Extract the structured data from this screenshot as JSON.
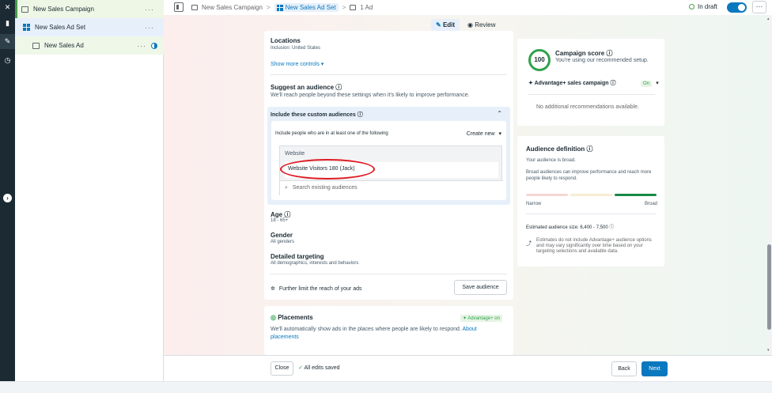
{
  "tree": {
    "campaign": "New Sales Campaign",
    "adset": "New Sales Ad Set",
    "ad": "New Sales Ad",
    "more": "···"
  },
  "topbar": {
    "crumb1": "New Sales Campaign",
    "crumb2": "New Sales Ad Set",
    "crumb3": "1 Ad",
    "sep": ">",
    "status": "In draft",
    "more": "···"
  },
  "tabs": {
    "edit": "Edit",
    "review": "Review"
  },
  "locations": {
    "title": "Locations",
    "value": "Inclusion: United States",
    "more_controls": "Show more controls ▾"
  },
  "suggest": {
    "title": "Suggest an audience",
    "desc": "We'll reach people beyond these settings when it's likely to improve performance."
  },
  "custom": {
    "title": "Include these custom audiences",
    "include_text": "Include people who are in at least one of the following",
    "create_new": "Create new",
    "group": "Website",
    "audience": "Website Visitors 180 (Jack)",
    "search_placeholder": "Search existing audiences"
  },
  "age": {
    "title": "Age",
    "value": "18 - 65+"
  },
  "gender": {
    "title": "Gender",
    "value": "All genders"
  },
  "detailed": {
    "title": "Detailed targeting",
    "value": "All demographics, interests and behaviors"
  },
  "further": {
    "label": "Further limit the reach of your ads",
    "save": "Save audience"
  },
  "placements": {
    "title": "Placements",
    "badge": "Advantage+ on",
    "desc": "We'll automatically show ads in the places where people are likely to respond.",
    "link": "About placements"
  },
  "score": {
    "value": "100",
    "title": "Campaign score",
    "desc": "You're using our recommended setup.",
    "adv_label": "Advantage+ sales campaign",
    "adv_state": "On",
    "no_recs": "No additional recommendations available."
  },
  "audience_def": {
    "title": "Audience definition",
    "broad": "Your audience is broad.",
    "broad_desc": "Broad audiences can improve performance and reach more people likely to respond.",
    "narrow": "Narrow",
    "broad_label": "Broad",
    "size": "Estimated audience size: 6,400 - 7,500",
    "note": "Estimates do not include Advantage+ audience options and may vary significantly over time based on your targeting selections and available data."
  },
  "footer": {
    "close": "Close",
    "saved": "All edits saved",
    "back": "Back",
    "next": "Next"
  },
  "colors": {
    "accent": "#0a78be",
    "success": "#31a24c",
    "highlight": "#e01b24"
  }
}
